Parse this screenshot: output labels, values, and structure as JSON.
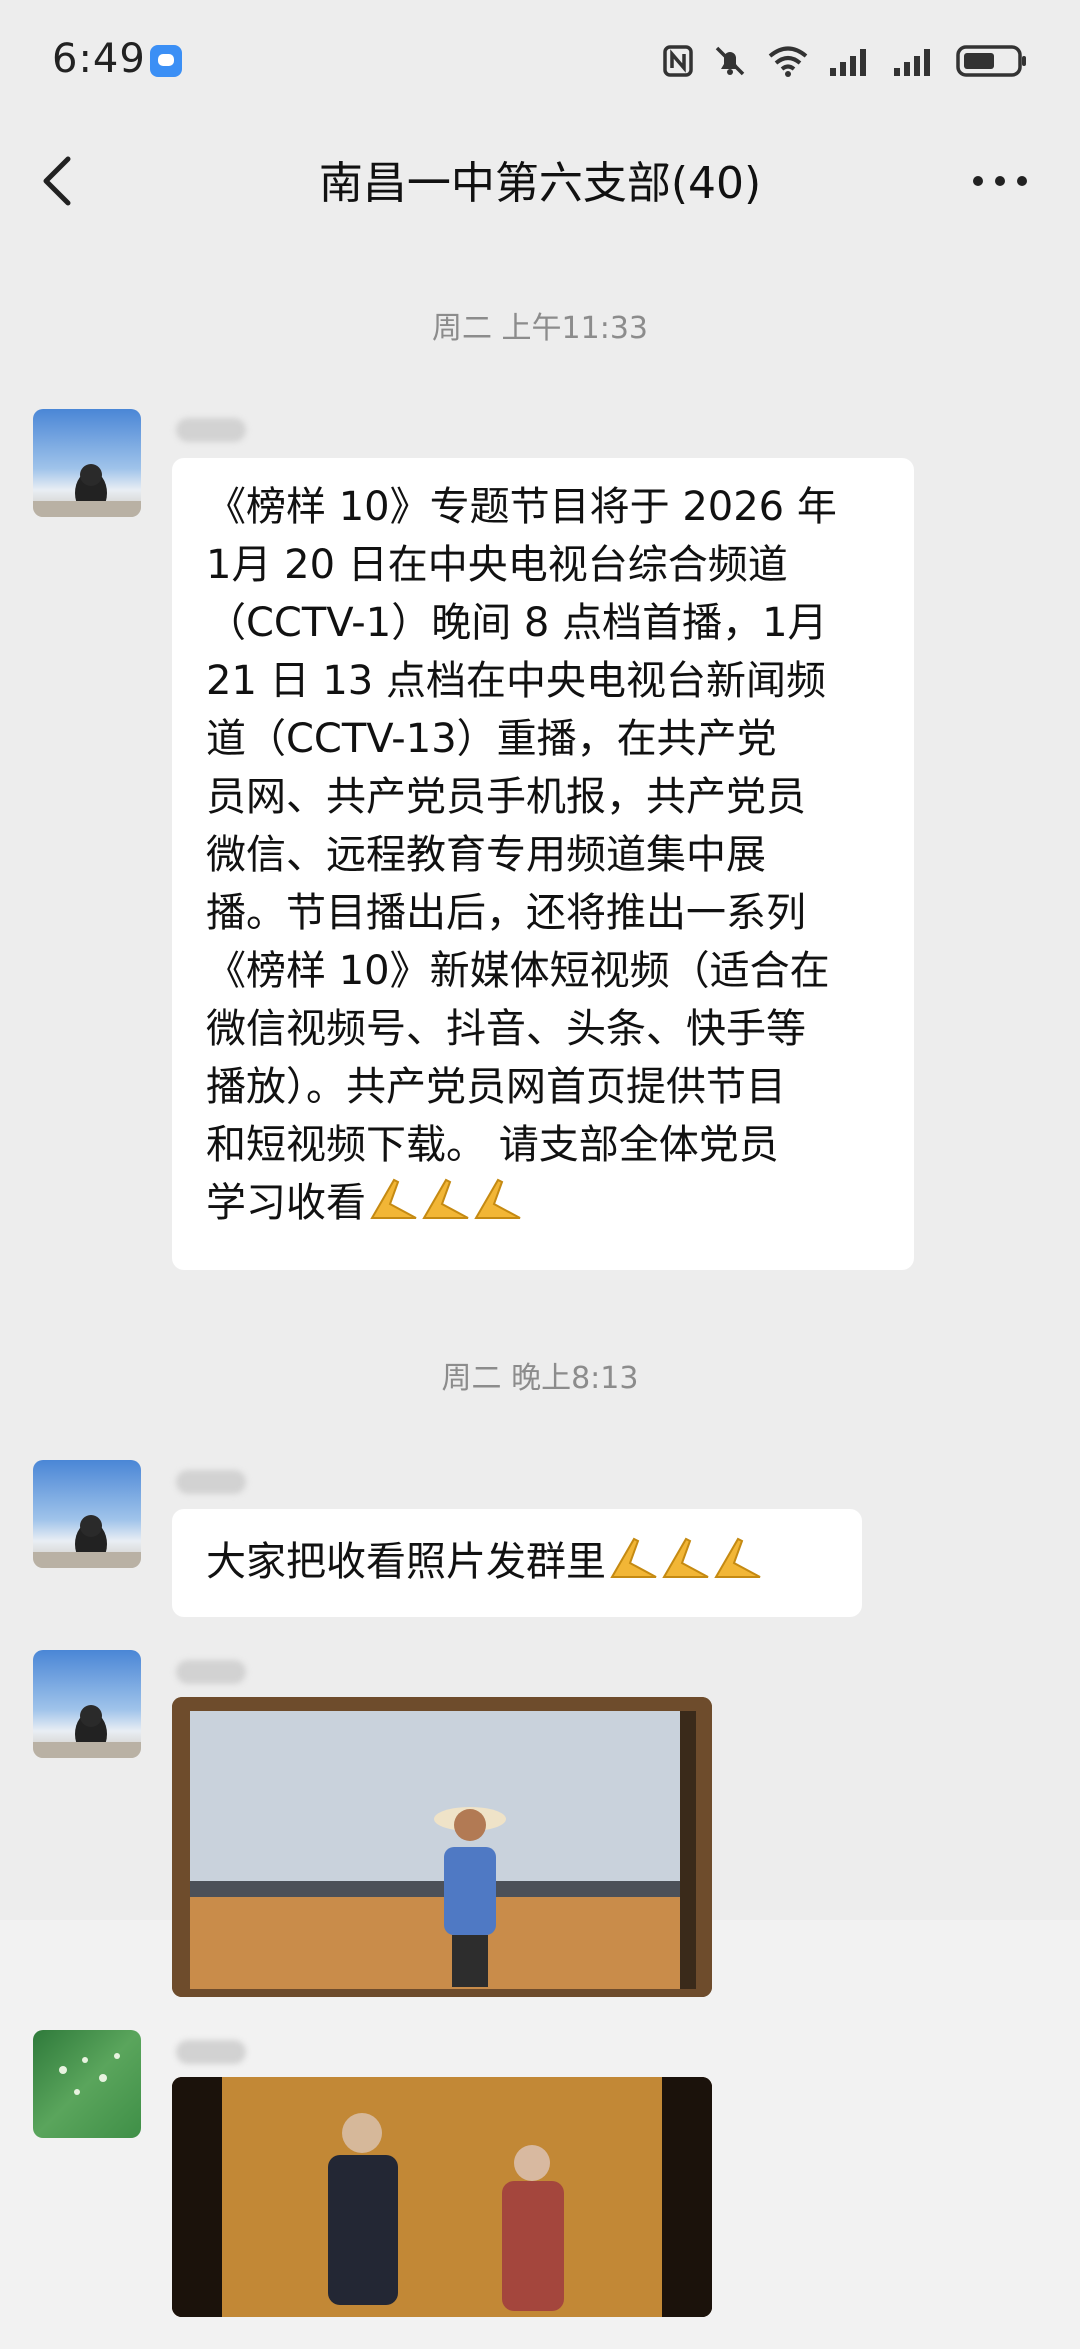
{
  "status_bar": {
    "time": "6:49"
  },
  "header": {
    "title": "南昌一中第六支部(40)"
  },
  "messages": {
    "timestamp1": "周二 上午11:33",
    "msg1": {
      "lines": [
        "《榜样 10》专题节目将于 2026 年",
        "1月 20 日在中央电视台综合频道",
        "（CCTV-1）晚间 8 点档首播，1月",
        "21 日 13 点档在中央电视台新闻频",
        "道（CCTV-13）重播，在共产党",
        "员网、共产党员手机报，共产党员",
        "微信、远程教育专用频道集中展",
        "播。节目播出后，还将推出一系列",
        "《榜样 10》新媒体短视频（适合在",
        "微信视频号、抖音、头条、快手等",
        "播放）。共产党员网首页提供节目",
        "和短视频下载。 请支部全体党员",
        "学习收看"
      ]
    },
    "timestamp2": "周二 晚上8:13",
    "msg2": {
      "text": "大家把收看照片发群里"
    },
    "photo1": {
      "caption": ""
    },
    "photo2": {
      "caption": ""
    }
  },
  "colors": {
    "background": "#ededed",
    "bubble": "#ffffff",
    "timestamp": "#8c8c8c"
  },
  "icons": [
    "nfc-icon",
    "mute-icon",
    "wifi-icon",
    "signal-icon",
    "battery-icon",
    "back-arrow-icon",
    "more-icon",
    "praise-hands-icon"
  ]
}
